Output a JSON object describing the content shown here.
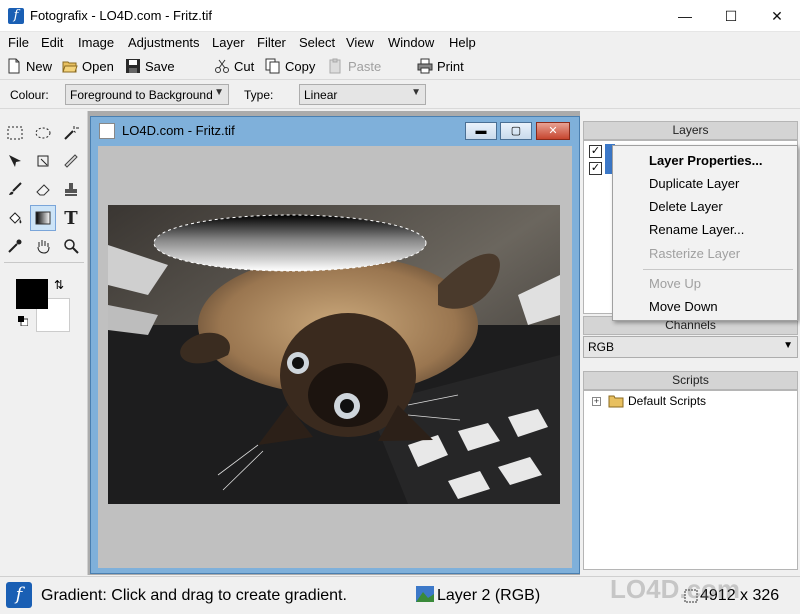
{
  "window": {
    "title": "Fotografix - LO4D.com - Fritz.tif",
    "minimize_glyph": "—",
    "maximize_glyph": "☐",
    "close_glyph": "✕"
  },
  "menu": [
    "File",
    "Edit",
    "Image",
    "Adjustments",
    "Layer",
    "Filter",
    "Select",
    "View",
    "Window",
    "Help"
  ],
  "toolbar": {
    "new_label": "New",
    "open_label": "Open",
    "save_label": "Save",
    "cut_label": "Cut",
    "copy_label": "Copy",
    "paste_label": "Paste",
    "print_label": "Print"
  },
  "options": {
    "colour_label": "Colour:",
    "colour_value": "Foreground to Background",
    "type_label": "Type:",
    "type_value": "Linear"
  },
  "document": {
    "title": "LO4D.com - Fritz.tif",
    "close_glyph": "✕"
  },
  "panels": {
    "layers_title": "Layers",
    "channels_title": "Channels",
    "channels_value": "RGB",
    "scripts_title": "Scripts",
    "scripts_item": "Default Scripts",
    "expand_glyph": "+"
  },
  "context_menu": {
    "items": [
      {
        "label": "Layer Properties...",
        "enabled": true,
        "bold": true
      },
      {
        "label": "Duplicate Layer",
        "enabled": true
      },
      {
        "label": "Delete Layer",
        "enabled": true
      },
      {
        "label": "Rename Layer...",
        "enabled": true
      },
      {
        "label": "Rasterize Layer",
        "enabled": false
      },
      {
        "label": "Move Up",
        "enabled": false
      },
      {
        "label": "Move Down",
        "enabled": true
      }
    ]
  },
  "status": {
    "message": "Gradient: Click and drag to create gradient.",
    "layer": "Layer 2 (RGB)",
    "size": "4912 x 326"
  },
  "watermark": "LO4D.com",
  "colors": {
    "accent": "#1a5fb4",
    "foreground": "#000000",
    "background": "#ffffff"
  }
}
